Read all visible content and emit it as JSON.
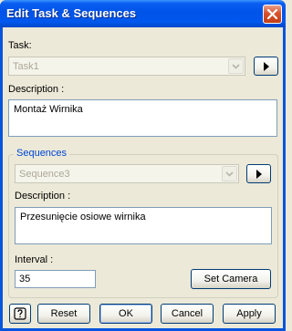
{
  "window": {
    "title": "Edit Task & Sequences"
  },
  "task": {
    "label": "Task:",
    "selected": "Task1",
    "description_label": "Description :",
    "description": "Montaż Wirnika"
  },
  "sequences": {
    "group_label": "Sequences",
    "selected": "Sequence3",
    "description_label": "Description :",
    "description": "Przesunięcie osiowe wirnika",
    "interval_label": "Interval :",
    "interval_value": "35",
    "set_camera_label": "Set Camera"
  },
  "footer": {
    "help_icon": "help-icon",
    "reset_label": "Reset",
    "ok_label": "OK",
    "cancel_label": "Cancel",
    "apply_label": "Apply"
  },
  "colors": {
    "titlebar": "#0058ee",
    "accent_text": "#0046d5",
    "close_button": "#d9532d",
    "dialog_background": "#ece9d8"
  }
}
